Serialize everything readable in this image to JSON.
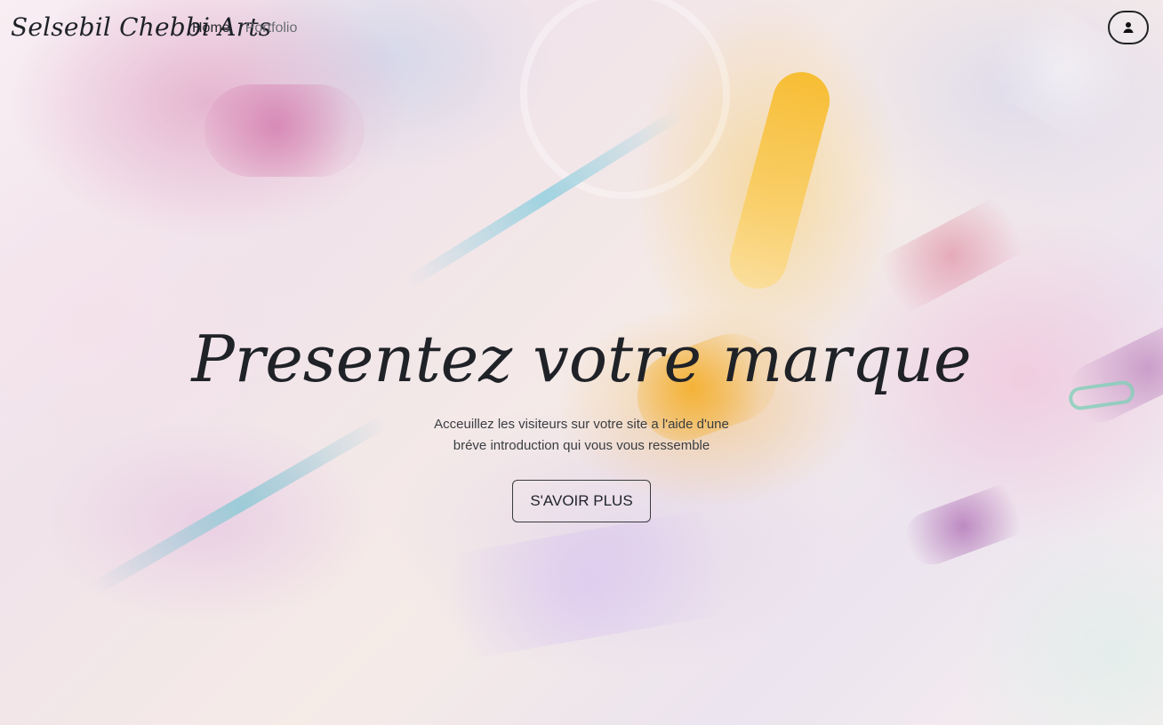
{
  "navbar": {
    "brand": "Selsebil Chebbi Arts",
    "links": [
      {
        "label": "Home",
        "state": "active"
      },
      {
        "label": "Portfolio",
        "state": "inactive"
      }
    ],
    "account_icon": "user-icon"
  },
  "hero": {
    "title": "Presentez votre marque",
    "description_lines": [
      "Acceuillez les visiteurs sur votre site a l'aide d'une",
      "bréve introduction qui vous vous ressemble"
    ],
    "cta_label": "S'AVOIR PLUS"
  },
  "colors": {
    "text_primary": "#212529",
    "text_muted": "#6b6e73",
    "button_border": "#3b3b3b"
  }
}
